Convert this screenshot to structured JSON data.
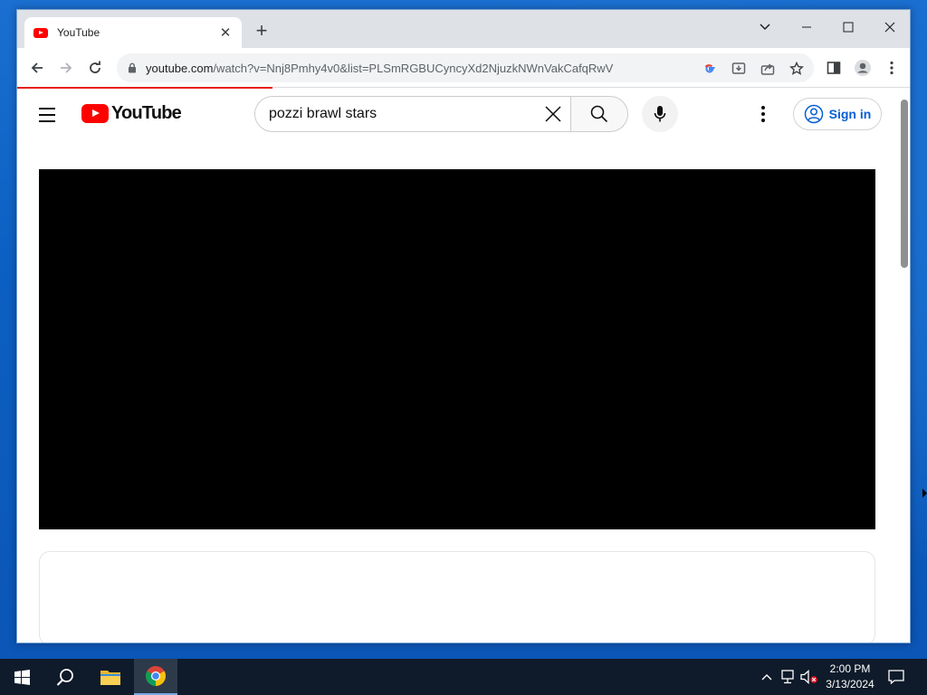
{
  "browser": {
    "tab_title": "YouTube",
    "new_tab_symbol": "+",
    "close_symbol": "✕",
    "url_host": "youtube.com",
    "url_path": "/watch?v=Nnj8Pmhy4v0&list=PLSmRGBUCyncyXd2NjuzkNWnVakCafqRwV"
  },
  "youtube": {
    "logo_text": "YouTube",
    "search_query": "pozzi brawl stars",
    "sign_in_label": "Sign in"
  },
  "taskbar": {
    "time": "2:00 PM",
    "date": "3/13/2024"
  },
  "colors": {
    "youtube_red": "#ff0000",
    "link_blue": "#065fd4",
    "taskbar_bg": "#0f1b2a"
  }
}
